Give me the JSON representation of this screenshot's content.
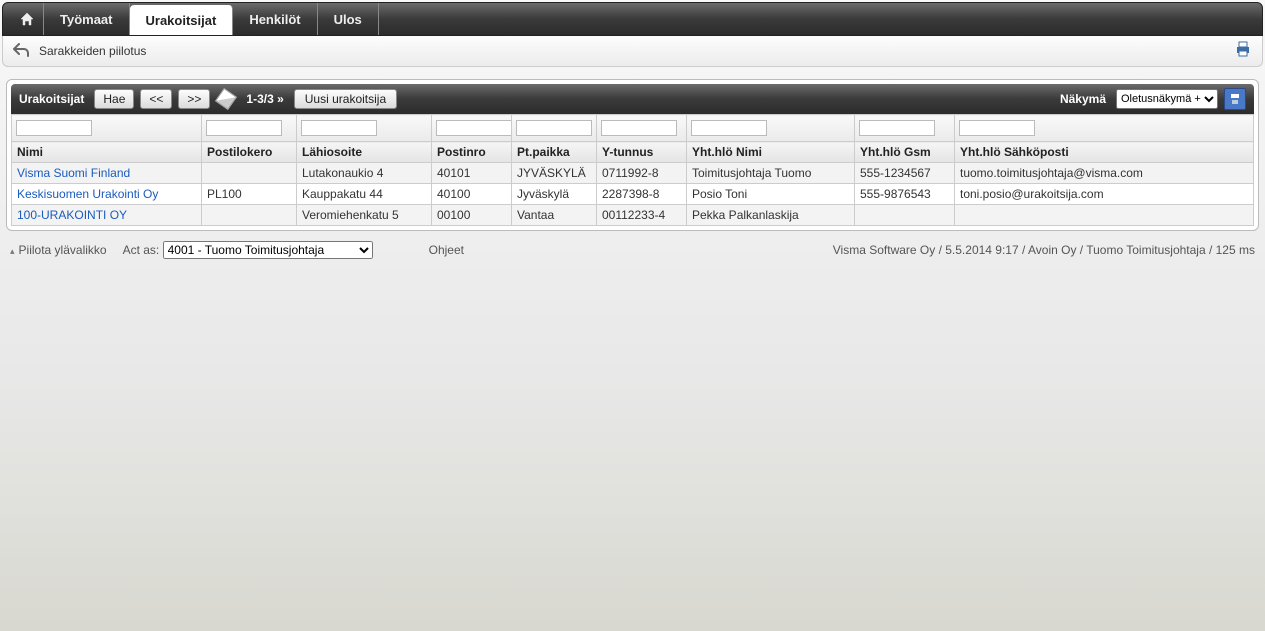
{
  "nav": {
    "tabs": [
      "Työmaat",
      "Urakoitsijat",
      "Henkilöt",
      "Ulos"
    ],
    "active": "Urakoitsijat"
  },
  "toolbar": {
    "columns_toggle": "Sarakkeiden piilotus"
  },
  "panel": {
    "title": "Urakoitsijat",
    "search_btn": "Hae",
    "prev_btn": "<<",
    "next_btn": ">>",
    "pager": "1-3/3 »",
    "new_btn": "Uusi urakoitsija",
    "view_label": "Näkymä",
    "view_select": "Oletusnäkymä +",
    "view_options": [
      "Oletusnäkymä +"
    ]
  },
  "columns": [
    "Nimi",
    "Postilokero",
    "Lähiosoite",
    "Postinro",
    "Pt.paikka",
    "Y-tunnus",
    "Yht.hlö Nimi",
    "Yht.hlö Gsm",
    "Yht.hlö Sähköposti"
  ],
  "rows": [
    {
      "nimi": "Visma Suomi Finland",
      "postilokero": "",
      "lahiosoite": "Lutakonaukio 4",
      "postinro": "40101",
      "ptpaikka": "JYVÄSKYLÄ",
      "ytunnus": "0711992-8",
      "yhtnimi": "Toimitusjohtaja Tuomo",
      "yhtgsm": "555-1234567",
      "yhtemail": "tuomo.toimitusjohtaja@visma.com"
    },
    {
      "nimi": "Keskisuomen Urakointi Oy",
      "postilokero": "PL100",
      "lahiosoite": "Kauppakatu 44",
      "postinro": "40100",
      "ptpaikka": "Jyväskylä",
      "ytunnus": "2287398-8",
      "yhtnimi": "Posio Toni",
      "yhtgsm": "555-9876543",
      "yhtemail": "toni.posio@urakoitsija.com"
    },
    {
      "nimi": "100-URAKOINTI OY",
      "postilokero": "",
      "lahiosoite": "Veromiehenkatu 5",
      "postinro": "00100",
      "ptpaikka": "Vantaa",
      "ytunnus": "00112233-4",
      "yhtnimi": "Pekka Palkanlaskija",
      "yhtgsm": "",
      "yhtemail": ""
    }
  ],
  "footer": {
    "hide_top": "Piilota ylävalikko",
    "act_as_label": "Act as:",
    "act_as_value": "4001 - Tuomo Toimitusjohtaja",
    "act_as_options": [
      "4001 - Tuomo Toimitusjohtaja"
    ],
    "help": "Ohjeet",
    "right": "Visma Software Oy / 5.5.2014 9:17 / Avoin Oy / Tuomo Toimitusjohtaja / 125 ms"
  }
}
